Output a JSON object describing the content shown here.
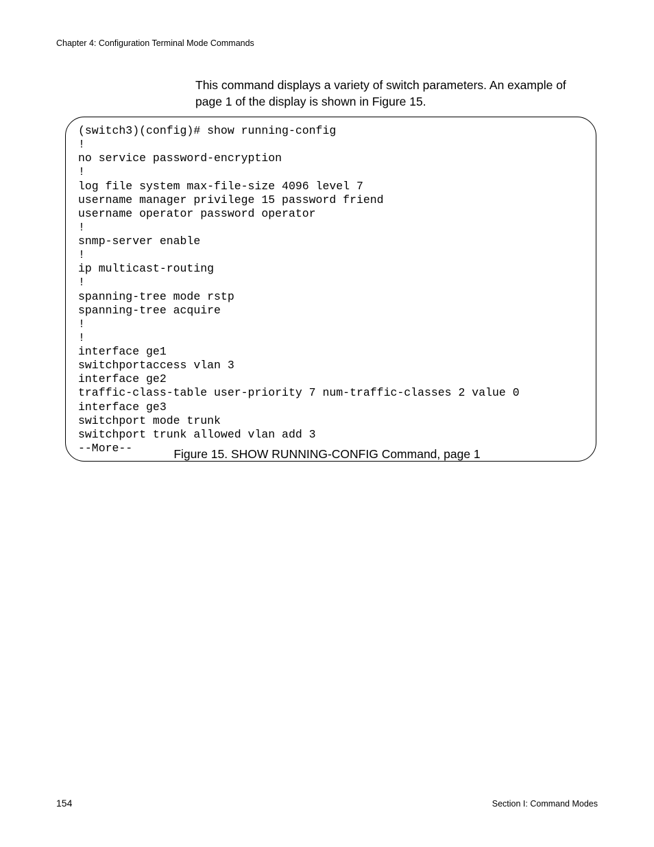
{
  "header": {
    "chapter_line": "Chapter 4: Configuration Terminal Mode Commands"
  },
  "intro": {
    "text": "This command displays a variety of switch parameters. An example of page 1 of the display is shown in Figure 15."
  },
  "code_block": {
    "content": "(switch3)(config)# show running-config\n!\nno service password-encryption\n!\nlog file system max-file-size 4096 level 7\nusername manager privilege 15 password friend\nusername operator password operator\n!\nsnmp-server enable\n!\nip multicast-routing\n!\nspanning-tree mode rstp\nspanning-tree acquire\n!\n!\ninterface ge1\nswitchportaccess vlan 3\ninterface ge2\ntraffic-class-table user-priority 7 num-traffic-classes 2 value 0\ninterface ge3\nswitchport mode trunk\nswitchport trunk allowed vlan add 3\n--More--"
  },
  "figure": {
    "caption": "Figure 15. SHOW RUNNING-CONFIG Command, page 1"
  },
  "footer": {
    "page_number": "154",
    "section": "Section I: Command Modes"
  }
}
